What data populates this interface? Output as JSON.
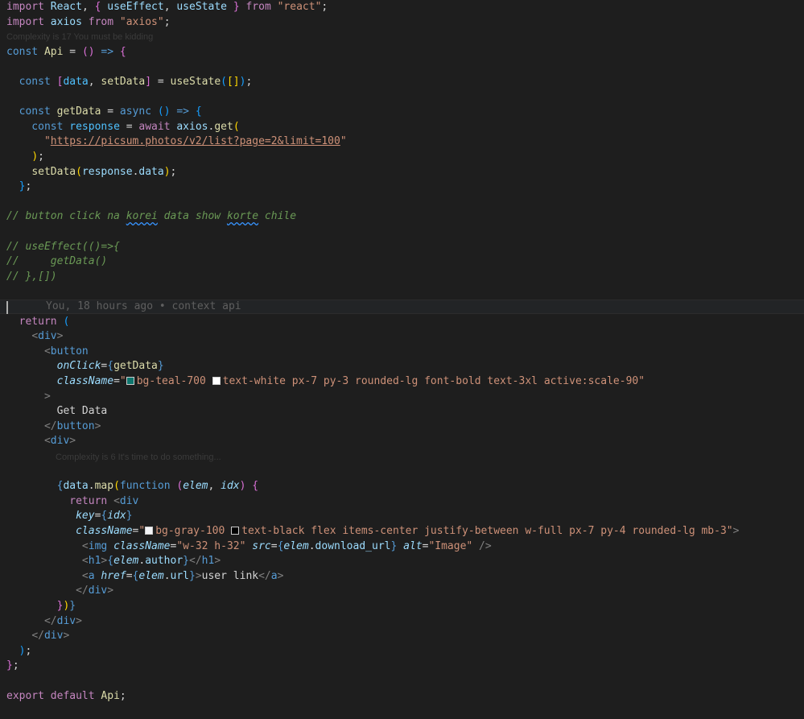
{
  "colors": {
    "background": "#1e1e1e",
    "keyword_control": "#c586c0",
    "keyword_decl": "#569cd6",
    "function": "#dcdcaa",
    "variable": "#9cdcfe",
    "constant": "#4fc1ff",
    "string": "#ce9178",
    "tag": "#569cd6",
    "bracket_1": "#ffd700",
    "bracket_2": "#da70d6",
    "bracket_3": "#179fff",
    "comment": "#6a9955",
    "text": "#d4d4d4",
    "swatch_teal": "#0f766e",
    "swatch_gray": "#f3f4f6",
    "swatch_white": "#ffffff",
    "swatch_black": "#000000"
  },
  "hints": {
    "complexity_top": "Complexity is 17 You must be kidding",
    "complexity_inner": "Complexity is 6 It's time to do something..."
  },
  "blame": {
    "text": "You, 18 hours ago • context api"
  },
  "lines": [
    [
      [
        "import",
        "#c586c0"
      ],
      [
        " React",
        "#9cdcfe"
      ],
      [
        ", ",
        "#d4d4d4"
      ],
      [
        "{",
        "#da70d6"
      ],
      [
        " useEffect",
        "#9cdcfe"
      ],
      [
        ", ",
        "#d4d4d4"
      ],
      [
        "useState",
        "#9cdcfe"
      ],
      [
        " ",
        "#d4d4d4"
      ],
      [
        "}",
        "#da70d6"
      ],
      [
        " from ",
        "#c586c0"
      ],
      [
        "\"react\"",
        "#ce9178"
      ],
      [
        ";",
        "#d4d4d4"
      ]
    ],
    [
      [
        "import",
        "#c586c0"
      ],
      [
        " axios ",
        "#9cdcfe"
      ],
      [
        "from ",
        "#c586c0"
      ],
      [
        "\"axios\"",
        "#ce9178"
      ],
      [
        ";",
        "#d4d4d4"
      ]
    ],
    [
      [
        "const ",
        "#569cd6"
      ],
      [
        "Api",
        "#dcdcaa"
      ],
      [
        " = ",
        "#d4d4d4"
      ],
      [
        "()",
        "#da70d6"
      ],
      [
        " ",
        "#d4d4d4"
      ],
      [
        "=>",
        "#569cd6"
      ],
      [
        " ",
        "#d4d4d4"
      ],
      [
        "{",
        "#da70d6"
      ]
    ],
    [],
    [
      [
        "  const ",
        "#569cd6"
      ],
      [
        "[",
        "#da70d6"
      ],
      [
        "data",
        "#4fc1ff"
      ],
      [
        ", ",
        "#d4d4d4"
      ],
      [
        "setData",
        "#dcdcaa"
      ],
      [
        "]",
        "#da70d6"
      ],
      [
        " = ",
        "#d4d4d4"
      ],
      [
        "useState",
        "#dcdcaa"
      ],
      [
        "(",
        "#179fff"
      ],
      [
        "[]",
        "#ffd700"
      ],
      [
        ")",
        "#179fff"
      ],
      [
        ";",
        "#d4d4d4"
      ]
    ],
    [],
    [
      [
        "  const ",
        "#569cd6"
      ],
      [
        "getData",
        "#dcdcaa"
      ],
      [
        " = ",
        "#d4d4d4"
      ],
      [
        "async ",
        "#569cd6"
      ],
      [
        "()",
        "#179fff"
      ],
      [
        " ",
        "#d4d4d4"
      ],
      [
        "=>",
        "#569cd6"
      ],
      [
        " ",
        "#d4d4d4"
      ],
      [
        "{",
        "#179fff"
      ]
    ],
    [
      [
        "    const ",
        "#569cd6"
      ],
      [
        "response",
        "#4fc1ff"
      ],
      [
        " = ",
        "#d4d4d4"
      ],
      [
        "await ",
        "#c586c0"
      ],
      [
        "axios",
        "#9cdcfe"
      ],
      [
        ".",
        "#d4d4d4"
      ],
      [
        "get",
        "#dcdcaa"
      ],
      [
        "(",
        "#ffd700"
      ]
    ],
    [
      [
        "      ",
        "#d4d4d4"
      ],
      [
        "\"",
        "#ce9178"
      ],
      [
        "https://picsum.photos/v2/list?page=2&limit=100",
        "#ce9178",
        "u"
      ],
      [
        "\"",
        "#ce9178"
      ]
    ],
    [
      [
        "    ",
        "#d4d4d4"
      ],
      [
        ")",
        "#ffd700"
      ],
      [
        ";",
        "#d4d4d4"
      ]
    ],
    [
      [
        "    ",
        "#d4d4d4"
      ],
      [
        "setData",
        "#dcdcaa"
      ],
      [
        "(",
        "#ffd700"
      ],
      [
        "response",
        "#9cdcfe"
      ],
      [
        ".",
        "#d4d4d4"
      ],
      [
        "data",
        "#9cdcfe"
      ],
      [
        ")",
        "#ffd700"
      ],
      [
        ";",
        "#d4d4d4"
      ]
    ],
    [
      [
        "  ",
        "#d4d4d4"
      ],
      [
        "}",
        "#179fff"
      ],
      [
        ";",
        "#d4d4d4"
      ]
    ],
    [],
    [
      [
        "// button click na ",
        "#6a9955",
        "i"
      ],
      [
        "korei",
        "#6a9955",
        "is"
      ],
      [
        " data show ",
        "#6a9955",
        "i"
      ],
      [
        "korte",
        "#6a9955",
        "is"
      ],
      [
        " chile",
        "#6a9955",
        "i"
      ]
    ],
    [],
    [
      [
        "// useEffect(()=>{",
        "#6a9955",
        "i"
      ]
    ],
    [
      [
        "//     getData()",
        "#6a9955",
        "i"
      ]
    ],
    [
      [
        "// },[])",
        "#6a9955",
        "i"
      ]
    ],
    [],
    [],
    [
      [
        "  return ",
        "#c586c0"
      ],
      [
        "(",
        "#179fff"
      ]
    ],
    [
      [
        "    ",
        "#d4d4d4"
      ],
      [
        "<",
        "#808080"
      ],
      [
        "div",
        "#569cd6"
      ],
      [
        ">",
        "#808080"
      ]
    ],
    [
      [
        "      ",
        "#d4d4d4"
      ],
      [
        "<",
        "#808080"
      ],
      [
        "button",
        "#569cd6"
      ]
    ],
    [
      [
        "        ",
        "#d4d4d4"
      ],
      [
        "onClick",
        "#9cdcfe",
        "i"
      ],
      [
        "=",
        "#d4d4d4"
      ],
      [
        "{",
        "#569cd6"
      ],
      [
        "getData",
        "#dcdcaa"
      ],
      [
        "}",
        "#569cd6"
      ]
    ],
    [
      [
        "        ",
        "#d4d4d4"
      ],
      [
        "className",
        "#9cdcfe",
        "i"
      ],
      [
        "=",
        "#d4d4d4"
      ],
      [
        "\"",
        "#ce9178"
      ],
      [
        "SW:teal",
        "#0f766e"
      ],
      [
        "bg-teal-700 ",
        "#ce9178"
      ],
      [
        "SW:white",
        "#ffffff"
      ],
      [
        "text-white px-7 py-3 rounded-lg font-bold text-3xl active:scale-90\"",
        "#ce9178"
      ]
    ],
    [
      [
        "      ",
        "#d4d4d4"
      ],
      [
        ">",
        "#808080"
      ]
    ],
    [
      [
        "        Get Data",
        "#d4d4d4"
      ]
    ],
    [
      [
        "      ",
        "#d4d4d4"
      ],
      [
        "</",
        "#808080"
      ],
      [
        "button",
        "#569cd6"
      ],
      [
        ">",
        "#808080"
      ]
    ],
    [
      [
        "      ",
        "#d4d4d4"
      ],
      [
        "<",
        "#808080"
      ],
      [
        "div",
        "#569cd6"
      ],
      [
        ">",
        "#808080"
      ]
    ],
    [],
    [
      [
        "        ",
        "#d4d4d4"
      ],
      [
        "{",
        "#569cd6"
      ],
      [
        "data",
        "#9cdcfe"
      ],
      [
        ".",
        "#d4d4d4"
      ],
      [
        "map",
        "#dcdcaa"
      ],
      [
        "(",
        "#ffd700"
      ],
      [
        "function ",
        "#569cd6"
      ],
      [
        "(",
        "#da70d6"
      ],
      [
        "elem",
        "#9cdcfe",
        "i"
      ],
      [
        ", ",
        "#d4d4d4"
      ],
      [
        "idx",
        "#9cdcfe",
        "i"
      ],
      [
        ")",
        "#da70d6"
      ],
      [
        " ",
        "#d4d4d4"
      ],
      [
        "{",
        "#da70d6"
      ]
    ],
    [
      [
        "          ",
        "#d4d4d4"
      ],
      [
        "return ",
        "#c586c0"
      ],
      [
        "<",
        "#808080"
      ],
      [
        "div",
        "#569cd6"
      ]
    ],
    [
      [
        "           ",
        "#d4d4d4"
      ],
      [
        "key",
        "#9cdcfe",
        "i"
      ],
      [
        "=",
        "#d4d4d4"
      ],
      [
        "{",
        "#569cd6"
      ],
      [
        "idx",
        "#9cdcfe",
        "i"
      ],
      [
        "}",
        "#569cd6"
      ]
    ],
    [
      [
        "           ",
        "#d4d4d4"
      ],
      [
        "className",
        "#9cdcfe",
        "i"
      ],
      [
        "=",
        "#d4d4d4"
      ],
      [
        "\"",
        "#ce9178"
      ],
      [
        "SW:gray",
        "#f3f4f6"
      ],
      [
        "bg-gray-100 ",
        "#ce9178"
      ],
      [
        "SW:black",
        "#000000"
      ],
      [
        "text-black flex items-center justify-between w-full px-7 py-4 rounded-lg mb-3\"",
        "#ce9178"
      ],
      [
        ">",
        "#808080"
      ]
    ],
    [
      [
        "            ",
        "#d4d4d4"
      ],
      [
        "<",
        "#808080"
      ],
      [
        "img ",
        "#569cd6"
      ],
      [
        "className",
        "#9cdcfe",
        "i"
      ],
      [
        "=",
        "#d4d4d4"
      ],
      [
        "\"w-32 h-32\"",
        "#ce9178"
      ],
      [
        " ",
        "#d4d4d4"
      ],
      [
        "src",
        "#9cdcfe",
        "i"
      ],
      [
        "=",
        "#d4d4d4"
      ],
      [
        "{",
        "#569cd6"
      ],
      [
        "elem",
        "#9cdcfe",
        "i"
      ],
      [
        ".",
        "#d4d4d4"
      ],
      [
        "download_url",
        "#9cdcfe"
      ],
      [
        "}",
        "#569cd6"
      ],
      [
        " ",
        "#d4d4d4"
      ],
      [
        "alt",
        "#9cdcfe",
        "i"
      ],
      [
        "=",
        "#d4d4d4"
      ],
      [
        "\"Image\"",
        "#ce9178"
      ],
      [
        " />",
        "#808080"
      ]
    ],
    [
      [
        "            ",
        "#d4d4d4"
      ],
      [
        "<",
        "#808080"
      ],
      [
        "h1",
        "#569cd6"
      ],
      [
        ">",
        "#808080"
      ],
      [
        "{",
        "#569cd6"
      ],
      [
        "elem",
        "#9cdcfe",
        "i"
      ],
      [
        ".",
        "#d4d4d4"
      ],
      [
        "author",
        "#9cdcfe"
      ],
      [
        "}",
        "#569cd6"
      ],
      [
        "</",
        "#808080"
      ],
      [
        "h1",
        "#569cd6"
      ],
      [
        ">",
        "#808080"
      ]
    ],
    [
      [
        "            ",
        "#d4d4d4"
      ],
      [
        "<",
        "#808080"
      ],
      [
        "a ",
        "#569cd6"
      ],
      [
        "href",
        "#9cdcfe",
        "i"
      ],
      [
        "=",
        "#d4d4d4"
      ],
      [
        "{",
        "#569cd6"
      ],
      [
        "elem",
        "#9cdcfe",
        "i"
      ],
      [
        ".",
        "#d4d4d4"
      ],
      [
        "url",
        "#9cdcfe"
      ],
      [
        "}",
        "#569cd6"
      ],
      [
        ">",
        "#808080"
      ],
      [
        "user link",
        "#d4d4d4"
      ],
      [
        "</",
        "#808080"
      ],
      [
        "a",
        "#569cd6"
      ],
      [
        ">",
        "#808080"
      ]
    ],
    [
      [
        "           ",
        "#d4d4d4"
      ],
      [
        "</",
        "#808080"
      ],
      [
        "div",
        "#569cd6"
      ],
      [
        ">",
        "#808080"
      ]
    ],
    [
      [
        "        ",
        "#d4d4d4"
      ],
      [
        "}",
        "#da70d6"
      ],
      [
        ")",
        "#ffd700"
      ],
      [
        "}",
        "#569cd6"
      ]
    ],
    [
      [
        "      ",
        "#d4d4d4"
      ],
      [
        "</",
        "#808080"
      ],
      [
        "div",
        "#569cd6"
      ],
      [
        ">",
        "#808080"
      ]
    ],
    [
      [
        "    ",
        "#d4d4d4"
      ],
      [
        "</",
        "#808080"
      ],
      [
        "div",
        "#569cd6"
      ],
      [
        ">",
        "#808080"
      ]
    ],
    [
      [
        "  ",
        "#d4d4d4"
      ],
      [
        ")",
        "#179fff"
      ],
      [
        ";",
        "#d4d4d4"
      ]
    ],
    [
      [
        "}",
        "#da70d6"
      ],
      [
        ";",
        "#d4d4d4"
      ]
    ],
    [],
    [
      [
        "export ",
        "#c586c0"
      ],
      [
        "default ",
        "#c586c0"
      ],
      [
        "Api",
        "#dcdcaa"
      ],
      [
        ";",
        "#d4d4d4"
      ]
    ]
  ]
}
